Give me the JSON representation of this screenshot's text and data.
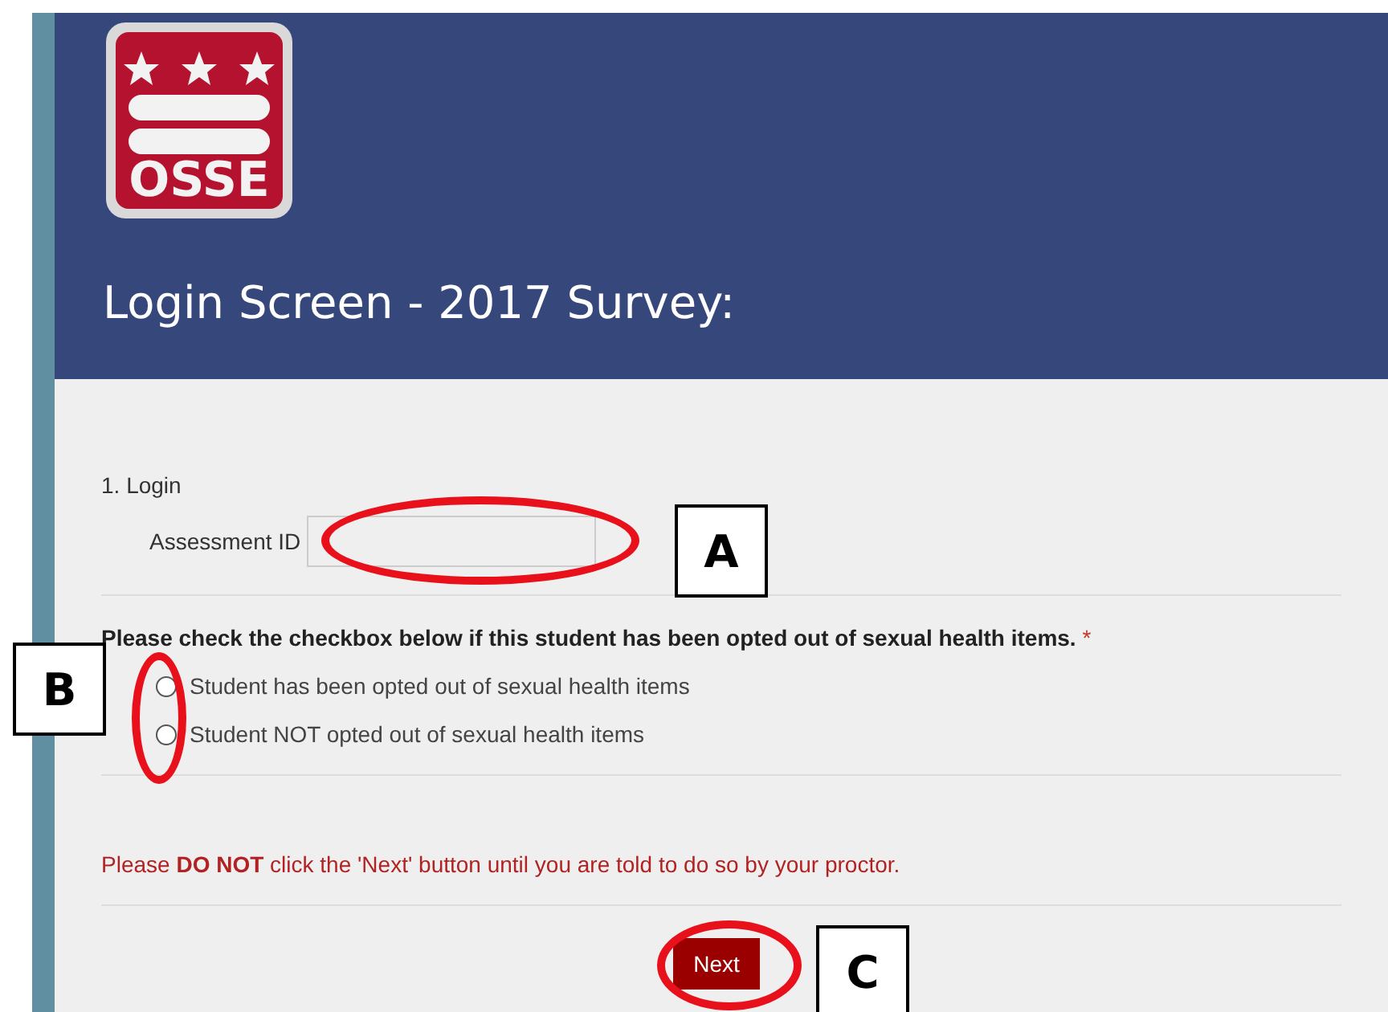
{
  "header": {
    "logo_text": "OSSE",
    "title": "Login Screen - 2017 Survey:"
  },
  "login": {
    "heading": "1. Login",
    "field_label": "Assessment ID"
  },
  "question": {
    "text": "Please check the checkbox below if this student has been opted out of sexual health items.",
    "required_mark": "*",
    "options": [
      {
        "label": "Student has been opted out of sexual health items",
        "selected": false
      },
      {
        "label": "Student NOT opted out of sexual health items",
        "selected": false
      }
    ]
  },
  "notice": "Please **DO NOT** click the 'Next' button until you are told to do so by your proctor.",
  "next_button": "Next",
  "annotations": [
    {
      "label": "A"
    },
    {
      "label": "B"
    },
    {
      "label": "C"
    }
  ]
}
